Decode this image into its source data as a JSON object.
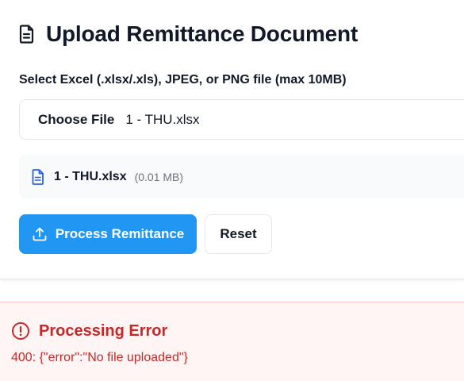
{
  "page": {
    "title": "Upload Remittance Document",
    "title_icon": "document-icon"
  },
  "upload": {
    "label": "Select Excel (.xlsx/.xls), JPEG, or PNG file (max 10MB)",
    "choose_file_label": "Choose File",
    "chosen_file_name": "1 - THU.xlsx"
  },
  "selected_file": {
    "icon": "file-text-icon",
    "name": "1 - THU.xlsx",
    "size": "(0.01 MB)"
  },
  "actions": {
    "process_label": "Process Remittance",
    "process_icon": "upload-icon",
    "reset_label": "Reset"
  },
  "error": {
    "icon": "alert-circle-icon",
    "title": "Processing Error",
    "message": "400: {\"error\":\"No file uploaded\"}"
  },
  "colors": {
    "primary": "#2196f3",
    "error": "#c62828",
    "error_bg": "#fff5f5"
  }
}
